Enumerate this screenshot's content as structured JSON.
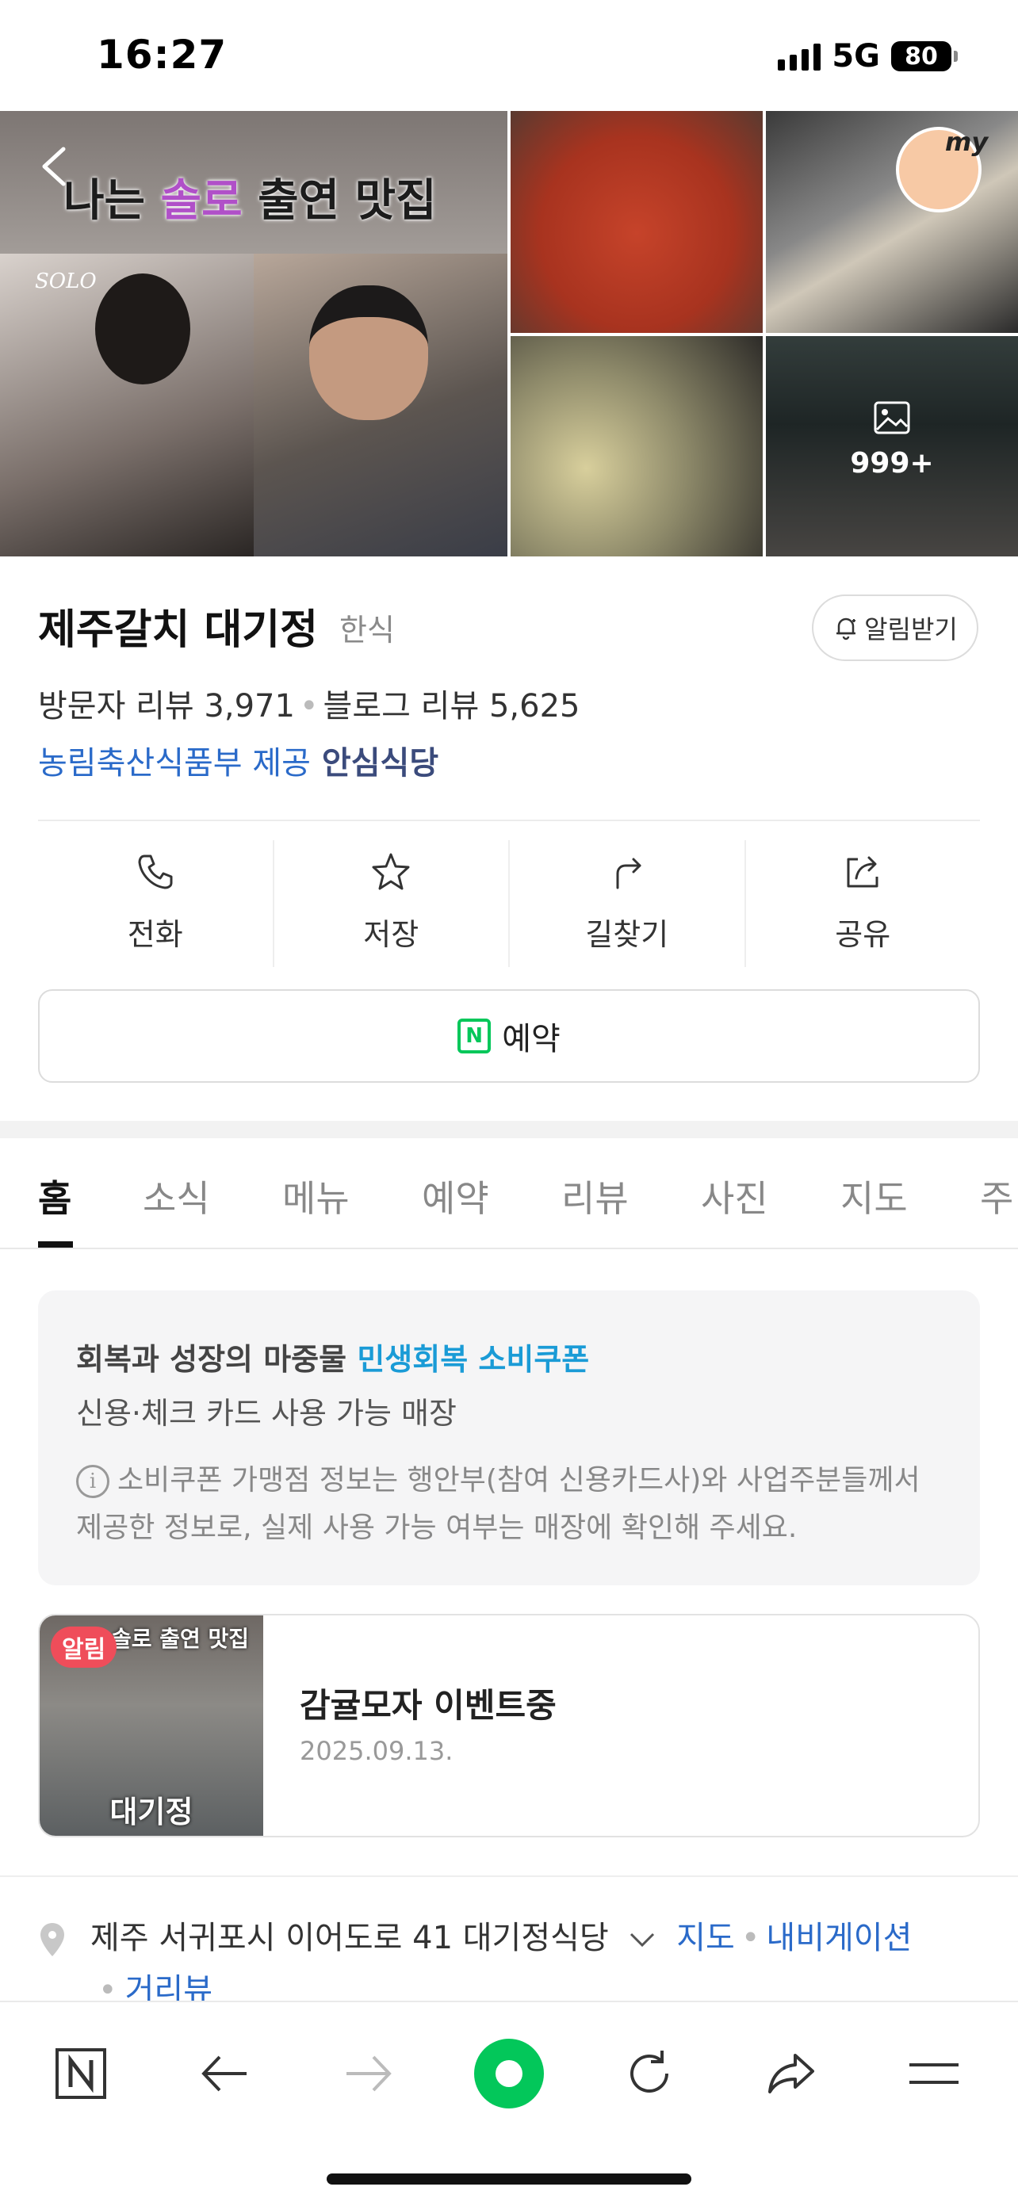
{
  "status_bar": {
    "time": "16:27",
    "network": "5G",
    "battery": "80"
  },
  "photos": {
    "main_banner_text_pre": "나는 ",
    "main_banner_text_hl": "솔로",
    "main_banner_text_post": " 출연 맛집",
    "main_logo": "SOLO",
    "badge_text": "my",
    "photo_count": "999+"
  },
  "place": {
    "name": "제주갈치 대기정",
    "category": "한식",
    "alarm_button": "알림받기",
    "visitor_reviews": "방문자 리뷰 3,971",
    "blog_reviews": "블로그 리뷰 5,625",
    "gov_provider": "농림축산식품부 제공",
    "safe_label": "안심식당"
  },
  "actions": [
    {
      "label": "전화",
      "icon": "phone-icon"
    },
    {
      "label": "저장",
      "icon": "star-icon"
    },
    {
      "label": "길찾기",
      "icon": "directions-icon"
    },
    {
      "label": "공유",
      "icon": "share-icon"
    }
  ],
  "reserve": {
    "label": "예약",
    "icon_letter": "N"
  },
  "tabs": [
    "홈",
    "소식",
    "메뉴",
    "예약",
    "리뷰",
    "사진",
    "지도",
    "주"
  ],
  "coupon": {
    "line1_pre": "회복과 성장의 마중물",
    "line1_hl": "민생회복 소비쿠폰",
    "line2": "신용·체크 카드 사용 가능 매장",
    "note": "소비쿠폰 가맹점 정보는 행안부(참여 신용카드사)와 사업주분들께서 제공한 정보로, 실제 사용 가능 여부는 매장에 확인해 주세요."
  },
  "news": {
    "badge": "알림",
    "thumb_top": "솔로 출연 맛집",
    "thumb_bottom": "대기정",
    "title": "감귤모자 이벤트중",
    "date": "2025.09.13."
  },
  "address": {
    "text": "제주 서귀포시 이어도로 41 대기정식당",
    "map": "지도",
    "navigation": "내비게이션",
    "street_view": "거리뷰"
  },
  "colors": {
    "accent_green": "#03c75a",
    "link_blue": "#2a6ac9",
    "coupon_blue": "#1a9bd6",
    "alert_red": "#ef4d5a"
  }
}
